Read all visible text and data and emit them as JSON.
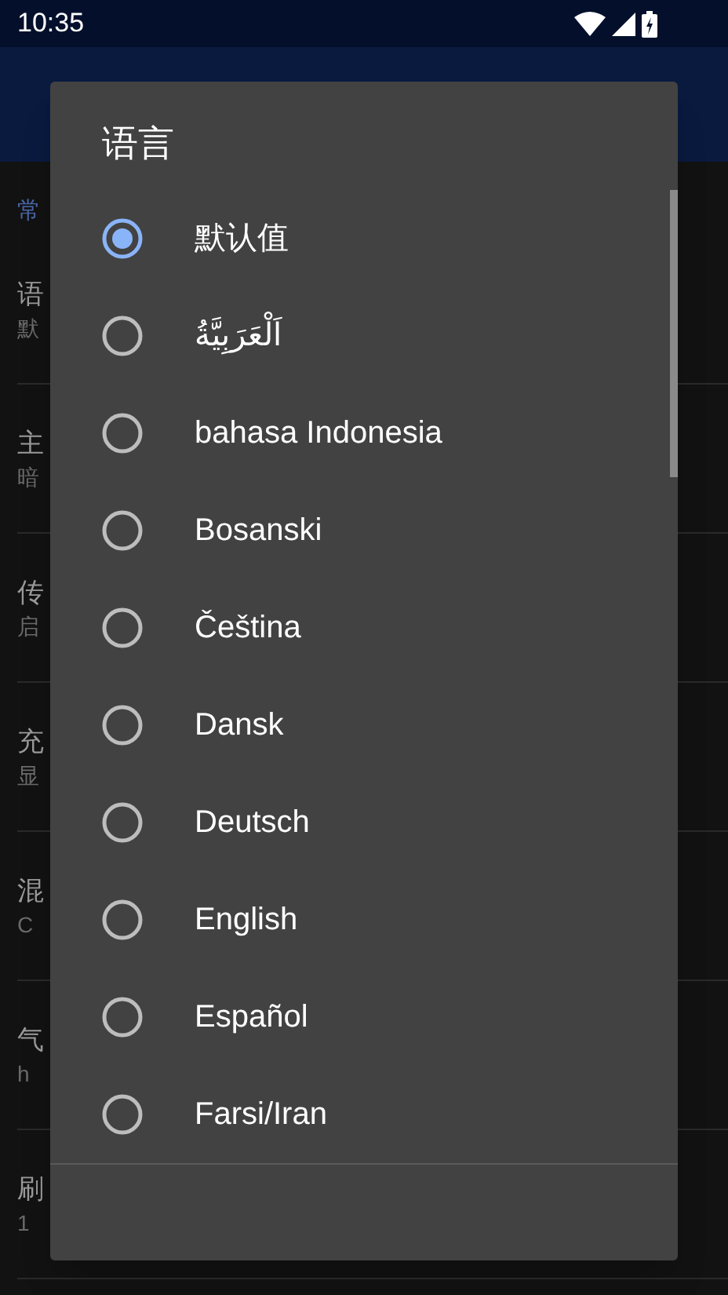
{
  "status_bar": {
    "time": "10:35"
  },
  "settings": {
    "section": "常",
    "rows": [
      {
        "title": "语",
        "subtitle": "默"
      },
      {
        "title": "主",
        "subtitle": "暗"
      },
      {
        "title": "传",
        "subtitle": "启"
      },
      {
        "title": "充",
        "subtitle": "显"
      },
      {
        "title": "混",
        "subtitle": "C"
      },
      {
        "title": "气",
        "subtitle": "h"
      },
      {
        "title": "刷",
        "subtitle": "1"
      }
    ]
  },
  "dialog": {
    "title": "语言",
    "options": [
      {
        "label": "默认值",
        "selected": true
      },
      {
        "label": "اَلْعَرَبِيَّةُ",
        "selected": false
      },
      {
        "label": "bahasa Indonesia",
        "selected": false
      },
      {
        "label": "Bosanski",
        "selected": false
      },
      {
        "label": "Čeština",
        "selected": false
      },
      {
        "label": "Dansk",
        "selected": false
      },
      {
        "label": "Deutsch",
        "selected": false
      },
      {
        "label": "English",
        "selected": false
      },
      {
        "label": "Español",
        "selected": false
      },
      {
        "label": "Farsi/Iran",
        "selected": false
      }
    ]
  }
}
